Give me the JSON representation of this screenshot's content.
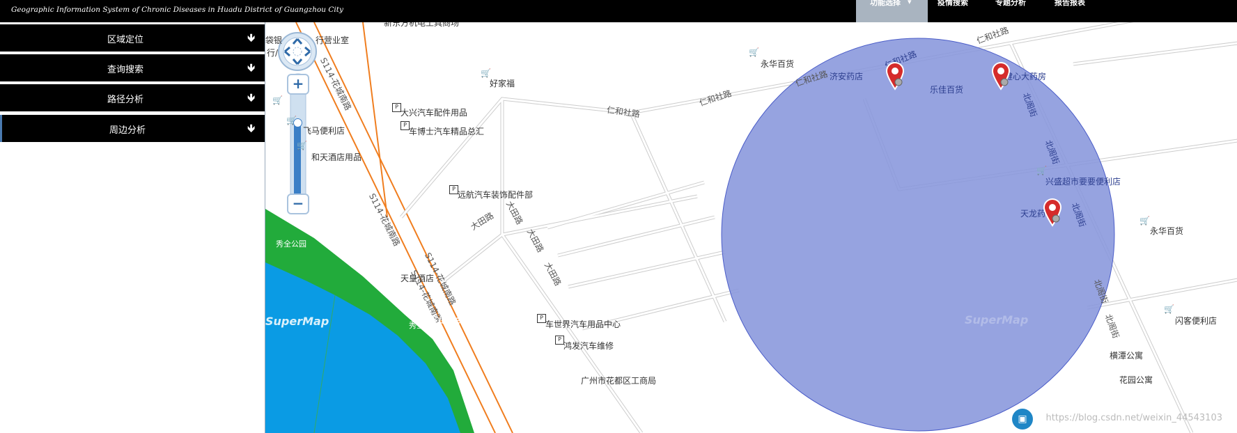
{
  "app_title": "Geographic Information System of Chronic Diseases in Huadu District of Guangzhou City",
  "topnav": {
    "func_select": "功能选择",
    "caret": "▾",
    "epidemic_search": "疫情搜索",
    "thematic_analysis": "专题分析",
    "report": "报告报表"
  },
  "sidebar": {
    "items": [
      {
        "label": "区域定位",
        "arrow": "🡻"
      },
      {
        "label": "查询搜索",
        "arrow": "🡻"
      },
      {
        "label": "路径分析",
        "arrow": "🡻"
      },
      {
        "label": "周边分析",
        "arrow": "🡻"
      }
    ]
  },
  "map": {
    "zoom_in": "+",
    "zoom_out": "−",
    "labels": {
      "a1": "新东方机电工具商场",
      "a2": "行营业室",
      "a3": "行/",
      "a4": "袋银",
      "a5": "好家福",
      "a6": "永华百货",
      "a7": "大兴汽车配件用品",
      "a8": "车博士汽车精品总汇",
      "a9": "飞马便利店",
      "a10": "和天酒店用品",
      "a11": "远航汽车装饰配件部",
      "a12": "秀全公园",
      "a13": "天皇酒店",
      "a14": "秀全",
      "a15": "车世界汽车用品中心",
      "a16": "鸿发汽车维修",
      "a17": "广州市花都区工商局",
      "a18": "济安药店",
      "a19": "乐佳百货",
      "a20": "健心大药房",
      "a21": "兴盛超市要要便利店",
      "a22": "天龙药",
      "a23": "永华百货",
      "a24": "闪客便利店",
      "a25": "横潭公寓",
      "a26": "花园公寓"
    },
    "roads": {
      "r1": "S114-花城南路",
      "r2": "S114-花城南路",
      "r3": "S114-花城南路",
      "r4": "S114-花城南路",
      "r5": "仁和社路",
      "r6": "仁和社路",
      "r7": "仁和社路",
      "r8": "仁和社路",
      "r9": "仁和社路",
      "r10": "大田路",
      "r11": "大田路",
      "r12": "大田路",
      "r13": "大田路",
      "r14": "北阁街",
      "r15": "北阁街",
      "r16": "北阁街",
      "r17": "北阁街",
      "r18": "北阁街"
    },
    "watermarks": {
      "supermap": "SuperMap",
      "url": "https://blog.csdn.net/weixin_44543103"
    },
    "buffer_color": "#8796dc"
  }
}
